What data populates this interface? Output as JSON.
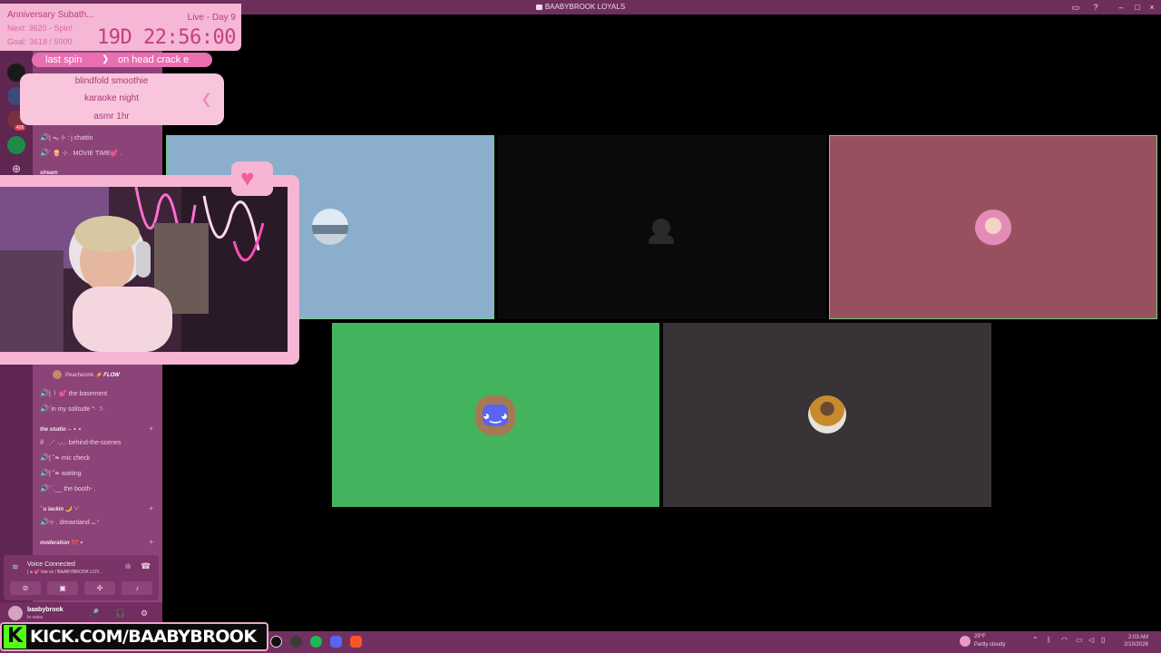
{
  "window": {
    "title": "BAABYBROOK LOYALS"
  },
  "overlay": {
    "sub_goal": {
      "title": "Anniversary Subath...",
      "next": "Next: 3620 - Spin!",
      "goal": "Goal: 3618 / 5000",
      "live_day": "Live - Day 9",
      "timer": "19D 22:56:00"
    },
    "spin": {
      "label": "last spin",
      "value": "on head crack e"
    },
    "wheel_items": [
      "blindfold smoothie",
      "karaoke night",
      "asmr 1hr"
    ],
    "kick_url": "KICK.COM/BAABYBROOK",
    "kick_logo": "K"
  },
  "sidebar": {
    "server_badges": [
      "426"
    ],
    "channels_top": [
      {
        "name": "| ᯓ ⊹ : j chattin",
        "type": "voice"
      },
      {
        "name": "` 🍿 ⊹ . MOVIE TIME💕 .",
        "type": "voice"
      }
    ],
    "category_stream": "stream",
    "channels_mid": [
      {
        "name": "| ꒰ 💕 the basement",
        "type": "voice"
      },
      {
        "name": "`in my solitude´°·☽·",
        "type": "voice"
      }
    ],
    "member": {
      "name": "Peachesmk",
      "tag": "⚡ FLOW"
    },
    "category_studio": "the studio ─ ⋆ ⋆",
    "channels_studio": [
      {
        "name": "⋰ ·,·,· behind-the-scenes",
        "type": "text"
      },
      {
        "name": "| ˚❧ mic check",
        "type": "voice"
      },
      {
        "name": "| ˚❧ waiting",
        "type": "voice"
      },
      {
        "name": "`˙.__ the booth- .",
        "type": "voice"
      }
    ],
    "category_lackin": "` u lackin 🌙 ˙ᵕ˙",
    "channels_lackin": [
      {
        "name": "⊹ . dreamland ᴗ.ᐟ",
        "type": "voice"
      }
    ],
    "category_moderation": "moderation 🎀 ⋆"
  },
  "voice_panel": {
    "status": "Voice Connected",
    "location": "| 𝚊 💕 live vc / BAABYBROOK LOY..."
  },
  "user": {
    "name": "baabybrook",
    "status": "In voice"
  },
  "taskbar": {
    "weather_temp": "29°F",
    "weather_cond": "Partly cloudy",
    "time": "2:03 AM",
    "date": "2/10/2026"
  },
  "colors": {
    "tile_blue": "#8aaecb",
    "tile_black": "#0a0a0a",
    "tile_rose": "#98505e",
    "tile_green": "#43b45d",
    "tile_dark": "#373336",
    "sidebar": "#8c4378",
    "accent_pink": "#f6b6d6"
  },
  "icons": [
    "gear-icon",
    "mic-icon",
    "headphones-icon",
    "discord-icon",
    "heart-icon",
    "hangup-icon"
  ]
}
